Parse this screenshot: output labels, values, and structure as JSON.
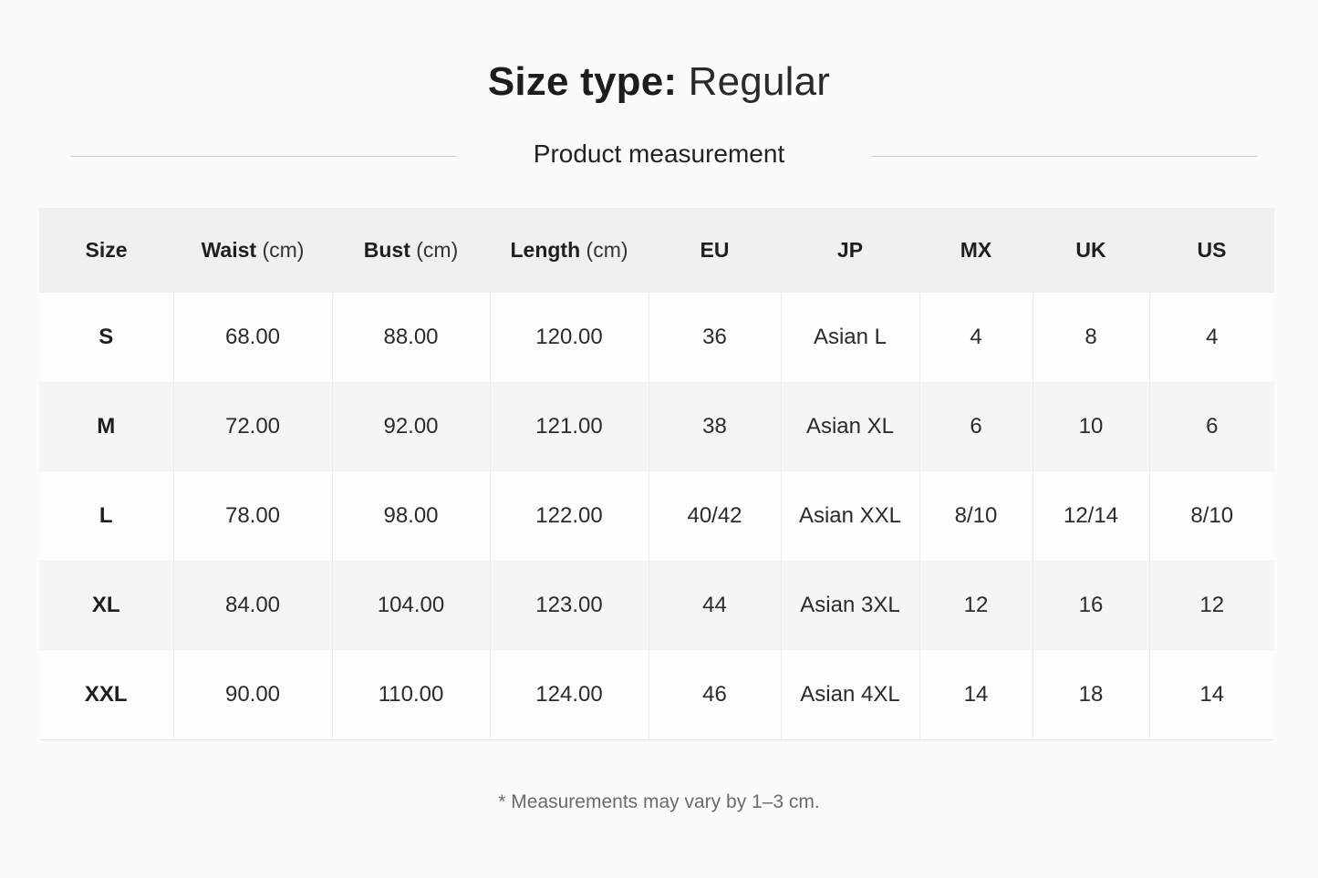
{
  "title": {
    "label": "Size type:",
    "value": "Regular"
  },
  "section": {
    "title": "Product measurement"
  },
  "table": {
    "headers": [
      {
        "name": "Size",
        "unit": ""
      },
      {
        "name": "Waist",
        "unit": "(cm)"
      },
      {
        "name": "Bust",
        "unit": "(cm)"
      },
      {
        "name": "Length",
        "unit": "(cm)"
      },
      {
        "name": "EU",
        "unit": ""
      },
      {
        "name": "JP",
        "unit": ""
      },
      {
        "name": "MX",
        "unit": ""
      },
      {
        "name": "UK",
        "unit": ""
      },
      {
        "name": "US",
        "unit": ""
      }
    ],
    "rows": [
      [
        "S",
        "68.00",
        "88.00",
        "120.00",
        "36",
        "Asian L",
        "4",
        "8",
        "4"
      ],
      [
        "M",
        "72.00",
        "92.00",
        "121.00",
        "38",
        "Asian XL",
        "6",
        "10",
        "6"
      ],
      [
        "L",
        "78.00",
        "98.00",
        "122.00",
        "40/42",
        "Asian XXL",
        "8/10",
        "12/14",
        "8/10"
      ],
      [
        "XL",
        "84.00",
        "104.00",
        "123.00",
        "44",
        "Asian 3XL",
        "12",
        "16",
        "12"
      ],
      [
        "XXL",
        "90.00",
        "110.00",
        "124.00",
        "46",
        "Asian 4XL",
        "14",
        "18",
        "14"
      ]
    ]
  },
  "footnote": "* Measurements may vary by 1–3 cm."
}
